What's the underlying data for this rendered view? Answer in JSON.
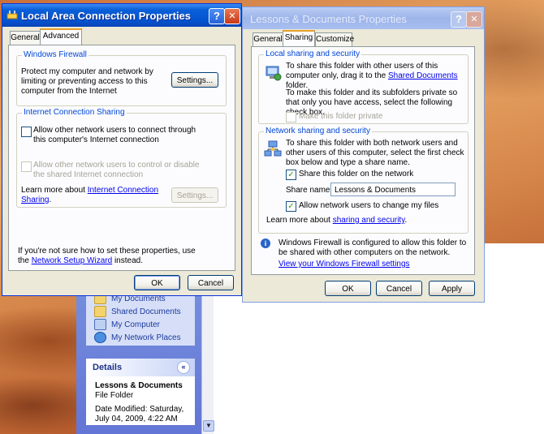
{
  "explorer": {
    "places": [
      {
        "label": "My Documents",
        "icon": "folder-documents-icon"
      },
      {
        "label": "Shared Documents",
        "icon": "folder-shared-icon"
      },
      {
        "label": "My Computer",
        "icon": "computer-icon"
      },
      {
        "label": "My Network Places",
        "icon": "network-places-icon"
      }
    ],
    "details": {
      "header": "Details",
      "toggle": "«",
      "name": "Lessons & Documents",
      "type": "File Folder",
      "date_modified": "Date Modified: Saturday, July 04, 2009, 4:22 AM"
    }
  },
  "lan_dialog": {
    "title": "Local Area Connection Properties",
    "help_btn": "?",
    "close_btn": "✕",
    "tabs": [
      "General",
      "Advanced"
    ],
    "active_tab": "Advanced",
    "firewall": {
      "legend": "Windows Firewall",
      "text": "Protect my computer and network by limiting or preventing access to this computer from the Internet",
      "settings_label": "Settings..."
    },
    "ics": {
      "legend": "Internet Connection Sharing",
      "allow_connect": "Allow other network users to connect through this computer's Internet connection",
      "allow_control": "Allow other network users to control or disable the shared Internet connection",
      "learn_prefix": "Learn more about ",
      "learn_link": "Internet Connection Sharing",
      "learn_suffix": ".",
      "settings_label": "Settings..."
    },
    "footer_line1": "If you're not sure how to set these properties, use",
    "footer_prefix": "the ",
    "footer_link": "Network Setup Wizard",
    "footer_suffix": " instead.",
    "ok_label": "OK",
    "cancel_label": "Cancel"
  },
  "lessons_dialog": {
    "title": "Lessons & Documents Properties",
    "help_btn": "?",
    "close_btn": "✕",
    "tabs": [
      "General",
      "Sharing",
      "Customize"
    ],
    "active_tab": "Sharing",
    "local": {
      "legend": "Local sharing and security",
      "text1_prefix": "To share this folder with other users of this computer only, drag it to the ",
      "text1_link": "Shared Documents",
      "text1_suffix": " folder.",
      "text2": "To make this folder and its subfolders private so that only you have access, select the following check box.",
      "make_private": "Make this folder private"
    },
    "network": {
      "legend": "Network sharing and security",
      "text": "To share this folder with both network users and other users of this computer, select the first check box below and type a share name.",
      "share_on_network": "Share this folder on the network",
      "share_on_network_checked": true,
      "share_name_label": "Share name:",
      "share_name_value": "Lessons & Documents",
      "allow_change": "Allow network users to change my files",
      "allow_change_checked": true,
      "learn_prefix": "Learn more about ",
      "learn_link": "sharing and security",
      "learn_suffix": "."
    },
    "firewall_info": "Windows Firewall is configured to allow this folder to be shared with other computers on the network.",
    "firewall_link": "View your Windows Firewall settings",
    "ok_label": "OK",
    "cancel_label": "Cancel",
    "apply_label": "Apply"
  },
  "colors": {
    "title_active": "#0a5fd8",
    "title_inactive": "#9db4e9",
    "close_red": "#e0532f",
    "link": "#0000ee",
    "group_legend": "#0046d5"
  }
}
